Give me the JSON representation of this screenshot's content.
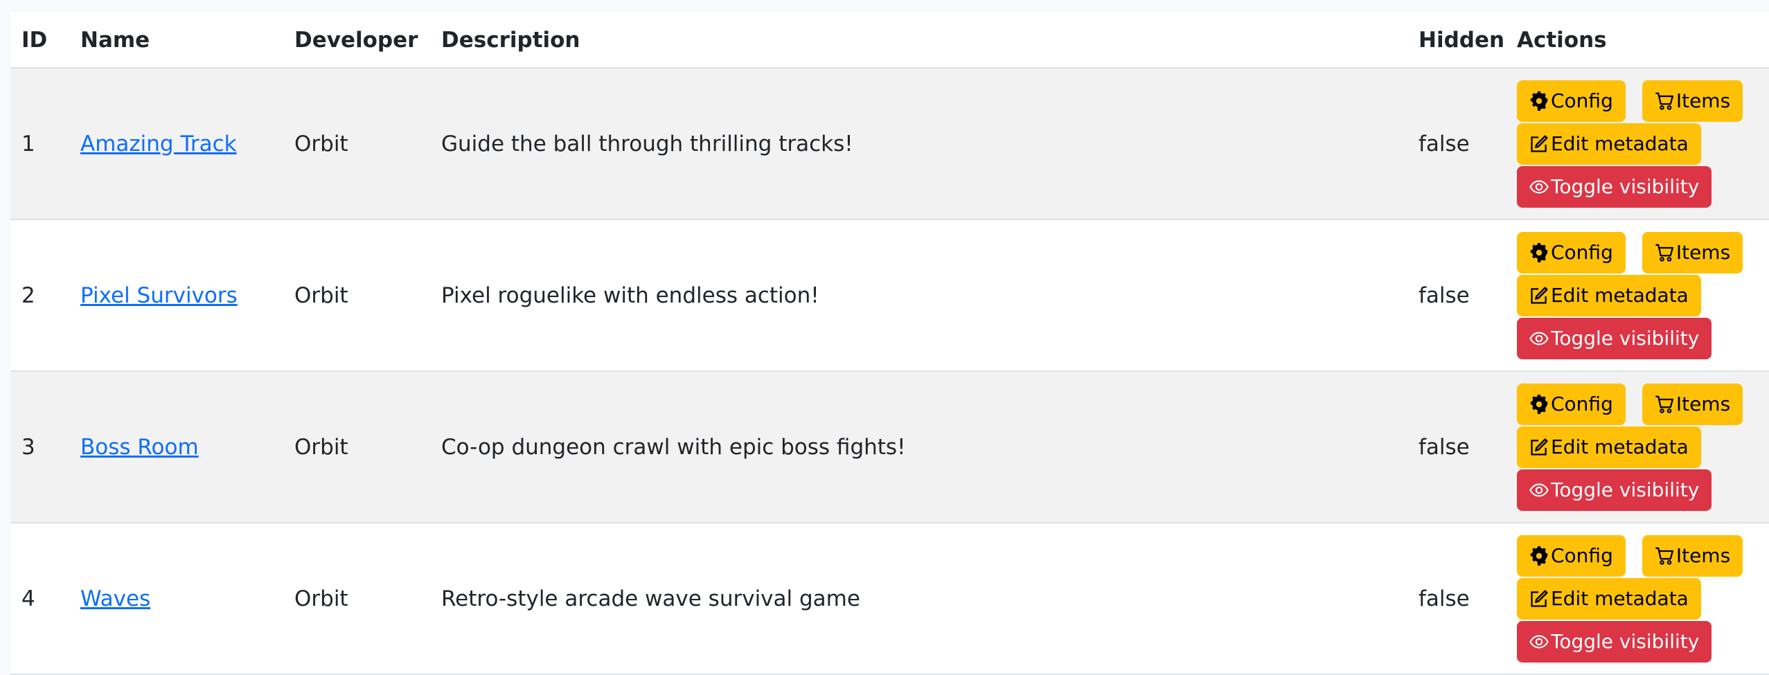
{
  "table": {
    "headers": {
      "id": "ID",
      "name": "Name",
      "developer": "Developer",
      "description": "Description",
      "hidden": "Hidden",
      "actions": "Actions"
    },
    "rows": [
      {
        "id": "1",
        "name": "Amazing Track",
        "developer": "Orbit",
        "description": "Guide the ball through thrilling tracks!",
        "hidden": "false"
      },
      {
        "id": "2",
        "name": "Pixel Survivors",
        "developer": "Orbit",
        "description": "Pixel roguelike with endless action!",
        "hidden": "false"
      },
      {
        "id": "3",
        "name": "Boss Room",
        "developer": "Orbit",
        "description": "Co-op dungeon crawl with epic boss fights!",
        "hidden": "false"
      },
      {
        "id": "4",
        "name": "Waves",
        "developer": "Orbit",
        "description": "Retro-style arcade wave survival game",
        "hidden": "false"
      }
    ]
  },
  "actions": {
    "config_label": "Config",
    "items_label": "Items",
    "edit_label": "Edit metadata",
    "toggle_label": "Toggle visibility",
    "icons": {
      "config": "gear-icon",
      "items": "cart-icon",
      "edit": "pencil-square-icon",
      "toggle": "eye-icon"
    }
  },
  "colors": {
    "link": "#0d6efd",
    "warning": "#ffc107",
    "danger": "#dc3545",
    "stripe": "#f2f2f2"
  }
}
